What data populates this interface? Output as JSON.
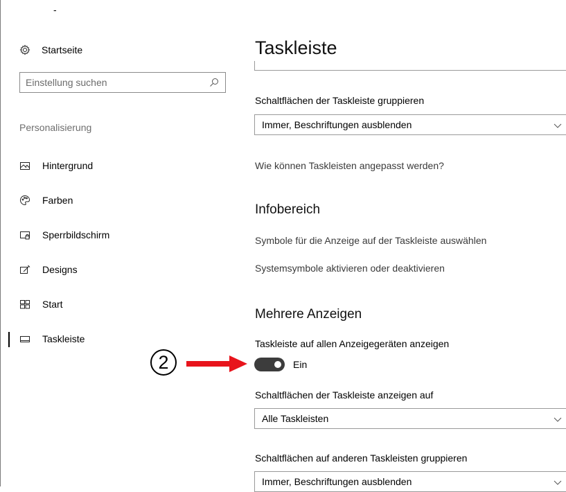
{
  "window": {
    "title_fragment": "-"
  },
  "sidebar": {
    "home_label": "Startseite",
    "search_placeholder": "Einstellung suchen",
    "section_label": "Personalisierung",
    "items": [
      {
        "label": "Hintergrund",
        "icon": "picture-icon"
      },
      {
        "label": "Farben",
        "icon": "palette-icon"
      },
      {
        "label": "Sperrbildschirm",
        "icon": "lock-screen-icon"
      },
      {
        "label": "Designs",
        "icon": "brush-icon"
      },
      {
        "label": "Start",
        "icon": "start-icon"
      },
      {
        "label": "Taskleiste",
        "icon": "taskbar-icon",
        "active": true
      }
    ]
  },
  "main": {
    "title": "Taskleiste",
    "group_buttons_label": "Schaltflächen der Taskleiste gruppieren",
    "group_buttons_value": "Immer, Beschriftungen ausblenden",
    "customize_link": "Wie können Taskleisten angepasst werden?",
    "infobereich_heading": "Infobereich",
    "select_icons_link": "Symbole für die Anzeige auf der Taskleiste auswählen",
    "system_icons_link": "Systemsymbole aktivieren oder deaktivieren",
    "multi_display_heading": "Mehrere Anzeigen",
    "show_all_label": "Taskleiste auf allen Anzeigegeräten anzeigen",
    "toggle_state": "Ein",
    "show_buttons_on_label": "Schaltflächen der Taskleiste anzeigen auf",
    "show_buttons_on_value": "Alle Taskleisten",
    "other_group_label": "Schaltflächen auf anderen Taskleisten gruppieren",
    "other_group_value": "Immer, Beschriftungen ausblenden"
  },
  "annotation": {
    "number": "2",
    "arrow_color": "#e8141c"
  }
}
